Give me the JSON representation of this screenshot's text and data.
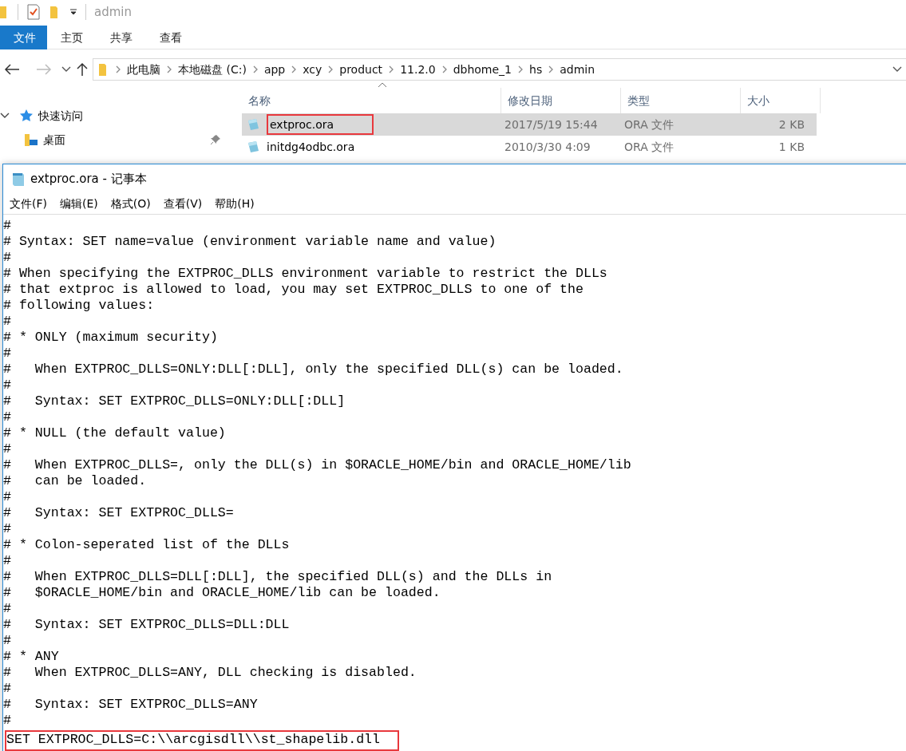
{
  "explorer": {
    "title": "admin",
    "ribbon_tabs": [
      {
        "label": "文件",
        "selected": true
      },
      {
        "label": "主页",
        "selected": false
      },
      {
        "label": "共享",
        "selected": false
      },
      {
        "label": "查看",
        "selected": false
      }
    ],
    "address_bar": {
      "crumbs": [
        "此电脑",
        "本地磁盘 (C:)",
        "app",
        "xcy",
        "product",
        "11.2.0",
        "dbhome_1",
        "hs",
        "admin"
      ]
    },
    "nav_pane": {
      "items": [
        {
          "label": "快速访问",
          "kind": "group"
        },
        {
          "label": "桌面",
          "kind": "pinned"
        }
      ]
    },
    "file_list": {
      "columns": [
        "名称",
        "修改日期",
        "类型",
        "大小"
      ],
      "rows": [
        {
          "name": "extproc.ora",
          "modified": "2017/5/19 15:44",
          "type": "ORA 文件",
          "size": "2 KB",
          "selected": true,
          "highlighted": true
        },
        {
          "name": "initdg4odbc.ora",
          "modified": "2010/3/30 4:09",
          "type": "ORA 文件",
          "size": "1 KB",
          "selected": false,
          "highlighted": false
        }
      ]
    }
  },
  "notepad": {
    "title": "extproc.ora - 记事本",
    "menu": [
      "文件(F)",
      "编辑(E)",
      "格式(O)",
      "查看(V)",
      "帮助(H)"
    ],
    "lines": [
      {
        "text": "#",
        "highlighted": false
      },
      {
        "text": "# Syntax: SET name=value (environment variable name and value)",
        "highlighted": false
      },
      {
        "text": "#",
        "highlighted": false
      },
      {
        "text": "# When specifying the EXTPROC_DLLS environment variable to restrict the DLLs",
        "highlighted": false
      },
      {
        "text": "# that extproc is allowed to load, you may set EXTPROC_DLLS to one of the",
        "highlighted": false
      },
      {
        "text": "# following values:",
        "highlighted": false
      },
      {
        "text": "#",
        "highlighted": false
      },
      {
        "text": "# * ONLY (maximum security)",
        "highlighted": false
      },
      {
        "text": "#",
        "highlighted": false
      },
      {
        "text": "#   When EXTPROC_DLLS=ONLY:DLL[:DLL], only the specified DLL(s) can be loaded.",
        "highlighted": false
      },
      {
        "text": "#",
        "highlighted": false
      },
      {
        "text": "#   Syntax: SET EXTPROC_DLLS=ONLY:DLL[:DLL]",
        "highlighted": false
      },
      {
        "text": "#",
        "highlighted": false
      },
      {
        "text": "# * NULL (the default value)",
        "highlighted": false
      },
      {
        "text": "#",
        "highlighted": false
      },
      {
        "text": "#   When EXTPROC_DLLS=, only the DLL(s) in $ORACLE_HOME/bin and ORACLE_HOME/lib",
        "highlighted": false
      },
      {
        "text": "#   can be loaded.",
        "highlighted": false
      },
      {
        "text": "#",
        "highlighted": false
      },
      {
        "text": "#   Syntax: SET EXTPROC_DLLS=",
        "highlighted": false
      },
      {
        "text": "#",
        "highlighted": false
      },
      {
        "text": "# * Colon-seperated list of the DLLs",
        "highlighted": false
      },
      {
        "text": "#",
        "highlighted": false
      },
      {
        "text": "#   When EXTPROC_DLLS=DLL[:DLL], the specified DLL(s) and the DLLs in",
        "highlighted": false
      },
      {
        "text": "#   $ORACLE_HOME/bin and ORACLE_HOME/lib can be loaded.",
        "highlighted": false
      },
      {
        "text": "#",
        "highlighted": false
      },
      {
        "text": "#   Syntax: SET EXTPROC_DLLS=DLL:DLL",
        "highlighted": false
      },
      {
        "text": "#",
        "highlighted": false
      },
      {
        "text": "# * ANY",
        "highlighted": false
      },
      {
        "text": "#   When EXTPROC_DLLS=ANY, DLL checking is disabled.",
        "highlighted": false
      },
      {
        "text": "#",
        "highlighted": false
      },
      {
        "text": "#   Syntax: SET EXTPROC_DLLS=ANY",
        "highlighted": false
      },
      {
        "text": "#",
        "highlighted": false
      },
      {
        "text": "SET EXTPROC_DLLS=C:\\\\arcgisdll\\\\st_shapelib.dll",
        "highlighted": true
      }
    ]
  }
}
